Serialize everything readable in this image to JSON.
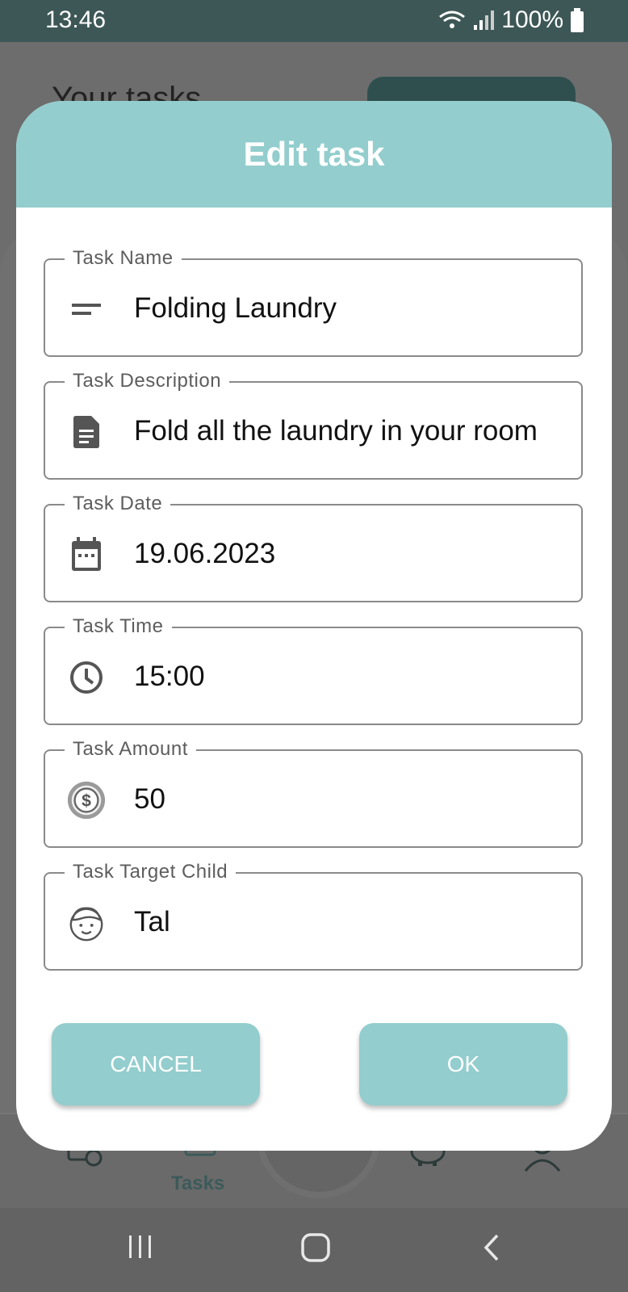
{
  "status": {
    "time": "13:46",
    "battery": "100%"
  },
  "background": {
    "title": "Your tasks",
    "nav_tasks_label": "Tasks"
  },
  "dialog": {
    "title": "Edit task",
    "fields": [
      {
        "label": "Task Name",
        "value": "Folding Laundry",
        "icon": "short-text-icon"
      },
      {
        "label": "Task Description",
        "value": "Fold all the laundry in your room",
        "icon": "document-icon"
      },
      {
        "label": "Task Date",
        "value": "19.06.2023",
        "icon": "calendar-icon"
      },
      {
        "label": "Task Time",
        "value": "15:00",
        "icon": "clock-icon"
      },
      {
        "label": "Task Amount",
        "value": "50",
        "icon": "dollar-coin-icon"
      },
      {
        "label": "Task Target Child",
        "value": "Tal",
        "icon": "child-face-icon"
      }
    ],
    "cancel_label": "CANCEL",
    "ok_label": "OK"
  },
  "colors": {
    "accent": "#93cdcd",
    "status_bar": "#3d5756"
  }
}
